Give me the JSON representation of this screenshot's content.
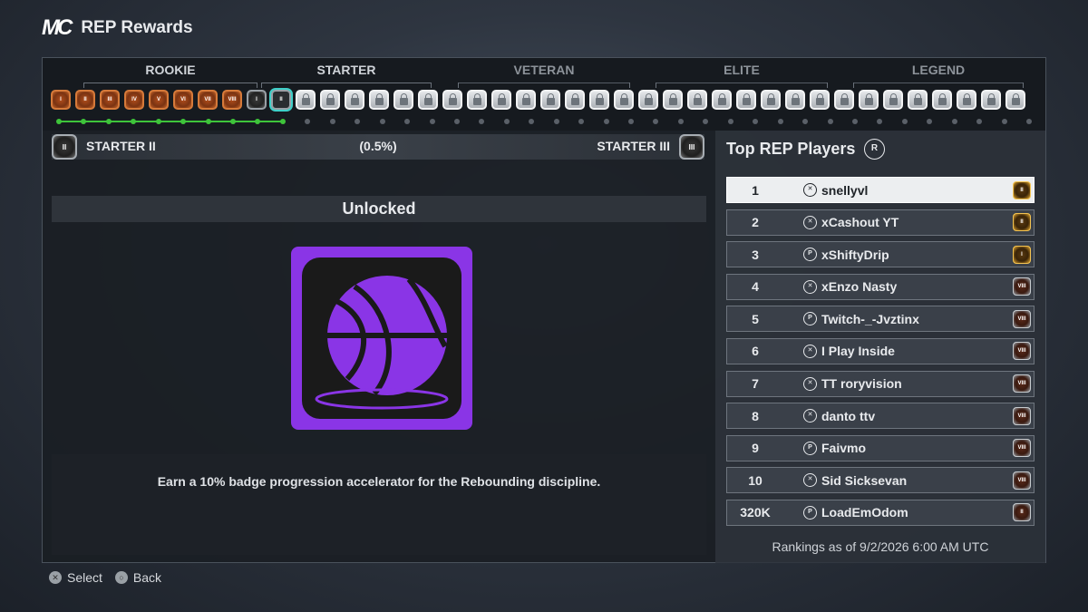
{
  "header": {
    "logo": "MC",
    "title": "REP Rewards"
  },
  "tiers": [
    {
      "label": "ROOKIE",
      "dim": false
    },
    {
      "label": "STARTER",
      "dim": false
    },
    {
      "label": "VETERAN",
      "dim": true
    },
    {
      "label": "ELITE",
      "dim": true
    },
    {
      "label": "LEGEND",
      "dim": true
    }
  ],
  "rookie_badges": [
    "I",
    "II",
    "III",
    "IV",
    "V",
    "VI",
    "VII",
    "VIII"
  ],
  "starter_done_badge": "I",
  "current_badge": "II",
  "progress": {
    "completed_dots": 10,
    "total_dots": 40
  },
  "rank_progress": {
    "from_label": "STARTER II",
    "from_badge": "II",
    "to_label": "STARTER III",
    "to_badge": "III",
    "percent_text": "(0.5%)",
    "percent": 0.5
  },
  "reward": {
    "status": "Unlocked",
    "icon": "basketball-icon",
    "accent": "#8a35e6",
    "description": "Earn a 10% badge progression accelerator for the Rebounding discipline."
  },
  "leaderboard": {
    "title": "Top REP Players",
    "button": "R",
    "rows": [
      {
        "rank": "1",
        "platform": "xbox",
        "name": "snellyvl",
        "tier": "gold",
        "tier_label": "II"
      },
      {
        "rank": "2",
        "platform": "xbox",
        "name": "xCashout YT",
        "tier": "gold",
        "tier_label": "II"
      },
      {
        "rank": "3",
        "platform": "playstation",
        "name": "xShiftyDrip",
        "tier": "gold",
        "tier_label": "I"
      },
      {
        "rank": "4",
        "platform": "xbox",
        "name": "xEnzo Nasty",
        "tier": "silver",
        "tier_label": "VIII"
      },
      {
        "rank": "5",
        "platform": "playstation",
        "name": "Twitch-_-Jvztinx",
        "tier": "silver",
        "tier_label": "VIII"
      },
      {
        "rank": "6",
        "platform": "xbox",
        "name": "I Play Inside",
        "tier": "silver",
        "tier_label": "VIII"
      },
      {
        "rank": "7",
        "platform": "xbox",
        "name": "TT roryvision",
        "tier": "silver",
        "tier_label": "VIII"
      },
      {
        "rank": "8",
        "platform": "xbox",
        "name": "danto ttv",
        "tier": "silver",
        "tier_label": "VIII"
      },
      {
        "rank": "9",
        "platform": "playstation",
        "name": "Faivmo",
        "tier": "silver",
        "tier_label": "VIII"
      },
      {
        "rank": "10",
        "platform": "xbox",
        "name": "Sid Sicksevan",
        "tier": "silver",
        "tier_label": "VIII"
      },
      {
        "rank": "320K",
        "platform": "playstation",
        "name": "LoadEmOdom",
        "tier": "silver",
        "tier_label": "II"
      }
    ],
    "footer": "Rankings as of 9/2/2026 6:00 AM UTC"
  },
  "hints": [
    {
      "icon": "x-button-icon",
      "label": "Select"
    },
    {
      "icon": "circle-button-icon",
      "label": "Back"
    }
  ]
}
